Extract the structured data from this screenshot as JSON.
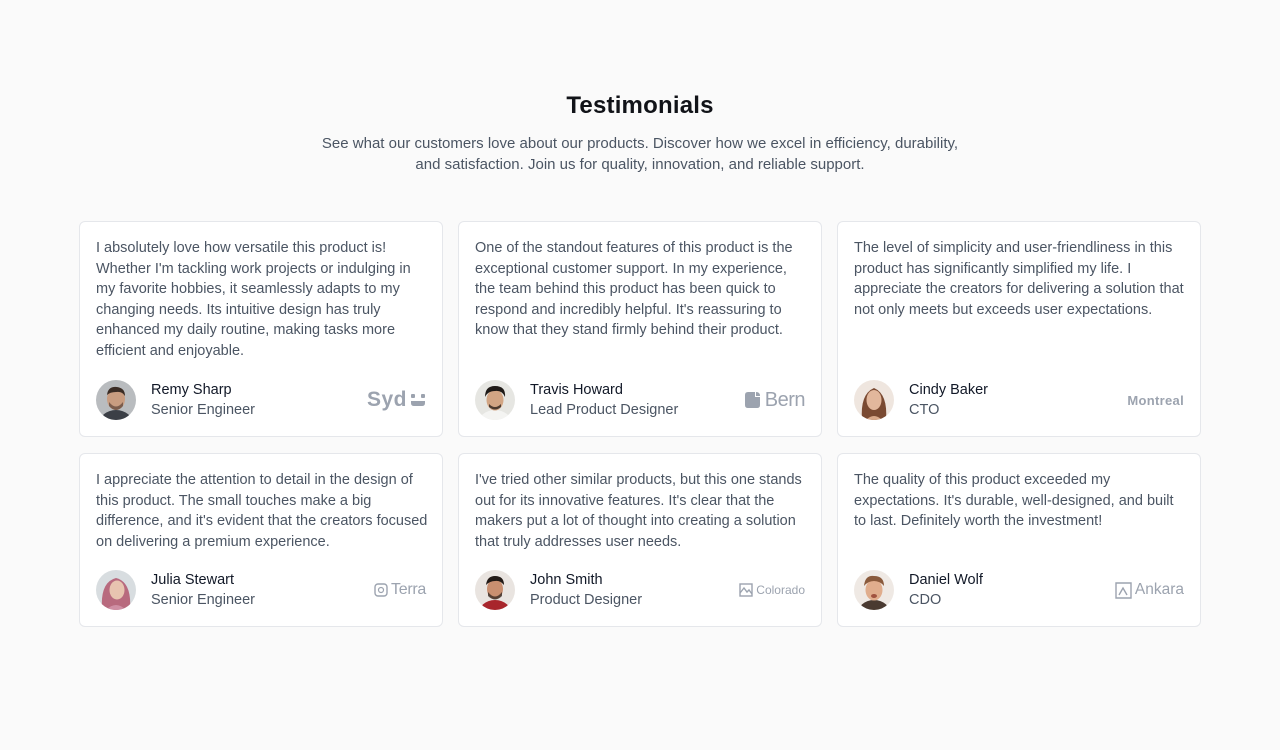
{
  "section": {
    "title": "Testimonials",
    "subtitle": "See what our customers love about our products. Discover how we excel in efficiency, durability, and satisfaction. Join us for quality, innovation, and reliable support."
  },
  "testimonials": [
    {
      "quote": "I absolutely love how versatile this product is! Whether I'm tackling work projects or indulging in my favorite hobbies, it seamlessly adapts to my changing needs. Its intuitive design has truly enhanced my daily routine, making tasks more efficient and enjoyable.",
      "name": "Remy Sharp",
      "role": "Senior Engineer",
      "logo": "Syd",
      "avatar_icon": "avatar-photo"
    },
    {
      "quote": "One of the standout features of this product is the exceptional customer support. In my experience, the team behind this product has been quick to respond and incredibly helpful. It's reassuring to know that they stand firmly behind their product.",
      "name": "Travis Howard",
      "role": "Lead Product Designer",
      "logo": "Bern",
      "avatar_icon": "avatar-photo"
    },
    {
      "quote": "The level of simplicity and user-friendliness in this product has significantly simplified my life. I appreciate the creators for delivering a solution that not only meets but exceeds user expectations.",
      "name": "Cindy Baker",
      "role": "CTO",
      "logo": "Montreal",
      "avatar_icon": "avatar-photo"
    },
    {
      "quote": "I appreciate the attention to detail in the design of this product. The small touches make a big difference, and it's evident that the creators focused on delivering a premium experience.",
      "name": "Julia Stewart",
      "role": "Senior Engineer",
      "logo": "Terra",
      "avatar_icon": "avatar-photo"
    },
    {
      "quote": "I've tried other similar products, but this one stands out for its innovative features. It's clear that the makers put a lot of thought into creating a solution that truly addresses user needs.",
      "name": "John Smith",
      "role": "Product Designer",
      "logo": "Colorado",
      "avatar_icon": "avatar-photo"
    },
    {
      "quote": "The quality of this product exceeded my expectations. It's durable, well-designed, and built to last. Definitely worth the investment!",
      "name": "Daniel Wolf",
      "role": "CDO",
      "logo": "Ankara",
      "avatar_icon": "avatar-photo"
    }
  ],
  "colors": {
    "background": "#fafafa",
    "card": "#ffffff",
    "border": "#e5e7eb",
    "text_primary": "#111827",
    "text_secondary": "#4b5563",
    "logo_gray": "#9ca3af"
  }
}
